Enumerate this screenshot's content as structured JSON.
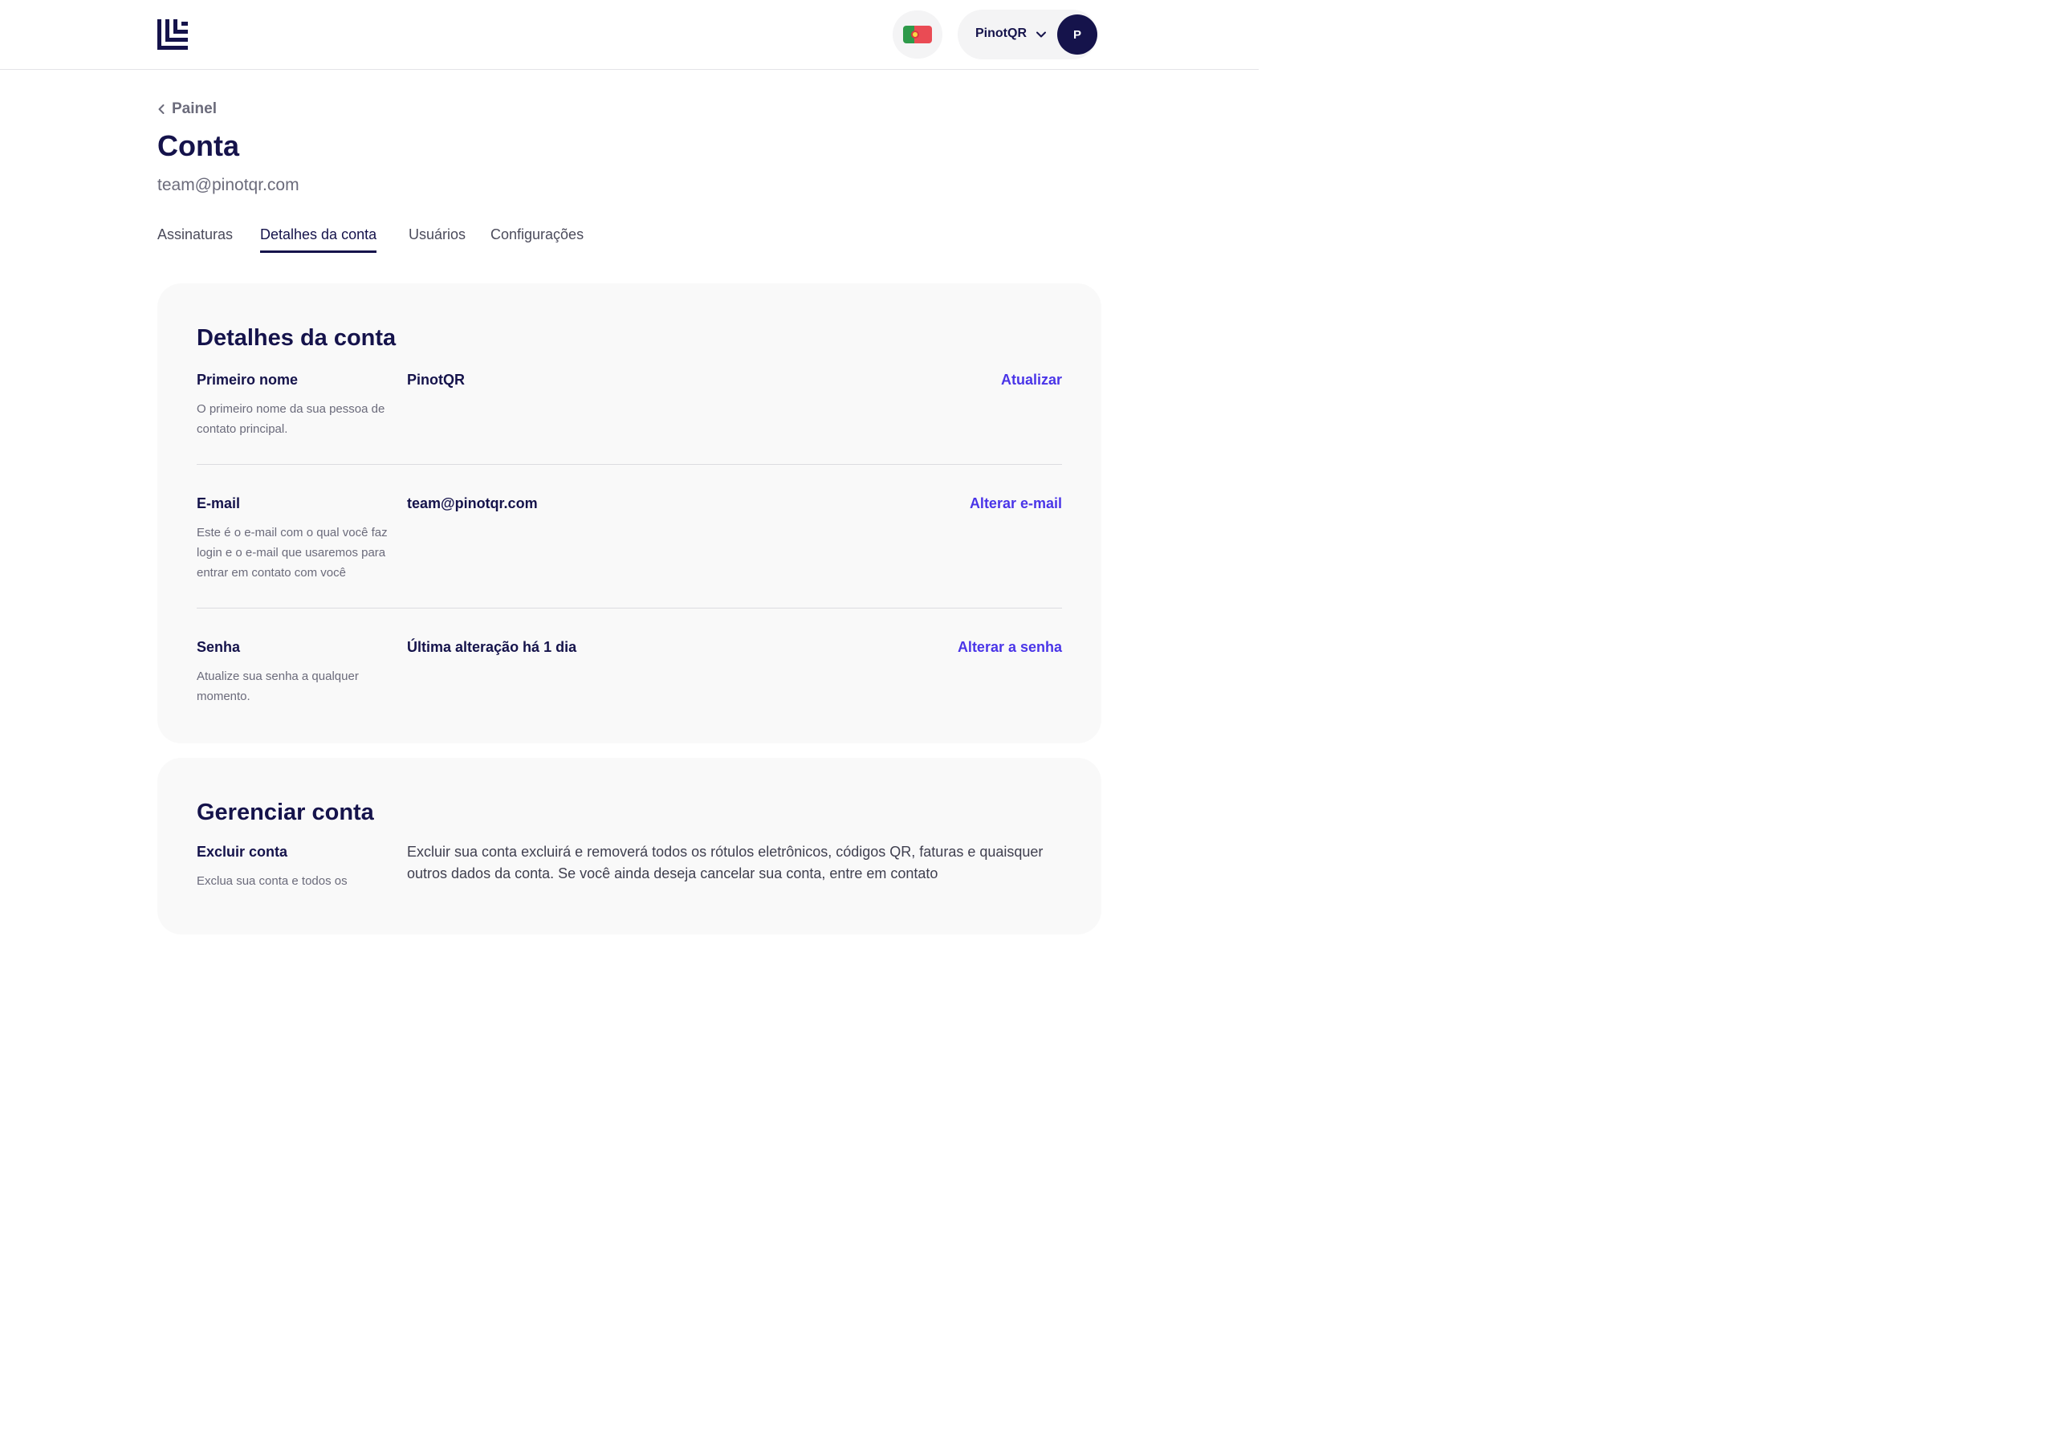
{
  "header": {
    "user_name": "PinotQR",
    "avatar_initial": "P",
    "language_flag": "portugal-flag-icon"
  },
  "breadcrumb": {
    "label": "Painel"
  },
  "page": {
    "title": "Conta",
    "email": "team@pinotqr.com"
  },
  "tabs": [
    {
      "label": "Assinaturas",
      "active": false
    },
    {
      "label": "Detalhes da conta",
      "active": true
    },
    {
      "label": "Usuários",
      "active": false
    },
    {
      "label": "Configurações",
      "active": false
    }
  ],
  "account_details": {
    "title": "Detalhes da conta",
    "rows": [
      {
        "label": "Primeiro nome",
        "description": "O primeiro nome da sua pessoa de contato principal.",
        "value": "PinotQR",
        "action": "Atualizar"
      },
      {
        "label": "E-mail",
        "description": "Este é o e-mail com o qual você faz login e o e-mail que usaremos para entrar em contato com você",
        "value": "team@pinotqr.com",
        "action": "Alterar e-mail"
      },
      {
        "label": "Senha",
        "description": "Atualize sua senha a qualquer momento.",
        "value": "Última alteração há 1 dia",
        "action": "Alterar a senha"
      }
    ]
  },
  "manage_account": {
    "title": "Gerenciar conta",
    "delete_label": "Excluir conta",
    "delete_description": "Exclua sua conta e todos os",
    "delete_text": "Excluir sua conta excluirá e removerá todos os rótulos eletrônicos, códigos QR, faturas e quaisquer outros dados da conta. Se você ainda deseja cancelar sua conta, entre em contato"
  },
  "colors": {
    "primary_text": "#15134b",
    "accent_link": "#4a35e8",
    "card_bg": "#f9f9f9",
    "muted_text": "#6b6b7b"
  }
}
